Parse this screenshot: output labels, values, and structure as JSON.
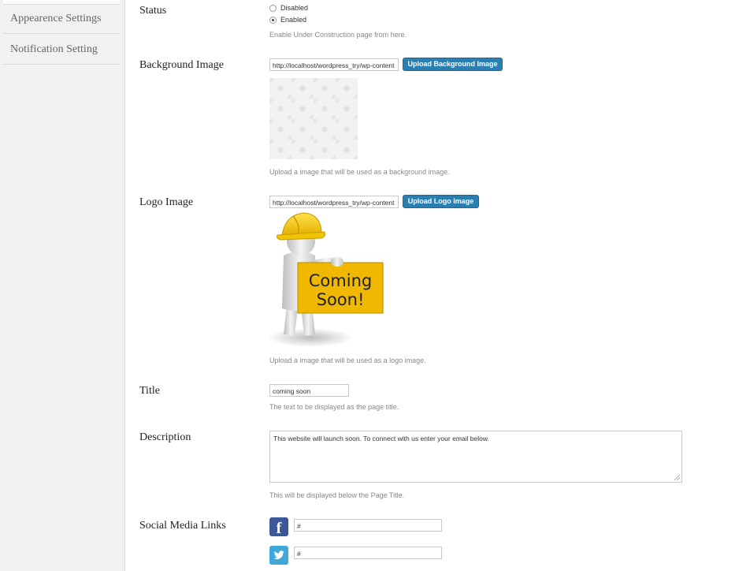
{
  "sidebar": {
    "items": [
      {
        "label": "Appearence Settings"
      },
      {
        "label": "Notification Setting"
      }
    ]
  },
  "status": {
    "label": "Status",
    "options": [
      "Disabled",
      "Enabled"
    ],
    "selected": "Enabled",
    "help": "Enable Under Construction page from here."
  },
  "background": {
    "label": "Background Image",
    "value": "http://localhost/wordpress_try/wp-content",
    "button": "Upload Background Image",
    "help": "Upload a image that will be used as a background image."
  },
  "logo": {
    "label": "Logo Image",
    "value": "http://localhost/wordpress_try/wp-content",
    "button": "Upload Logo Image",
    "sign_line1": "Coming",
    "sign_line2": "Soon!",
    "help": "Upload a image that will be used as a logo image."
  },
  "title": {
    "label": "Title",
    "value": "coming soon",
    "help": "The text to be displayed as the page title."
  },
  "description": {
    "label": "Description",
    "value": "This website will launch soon. To connect with us enter your email below.",
    "help": "This will be displayed below the Page Title."
  },
  "social": {
    "label": "Social Media Links",
    "facebook_icon": "f",
    "facebook_value": "#",
    "twitter_value": "#"
  },
  "colors": {
    "button": "#2a7fb0",
    "facebook": "#3b5998",
    "twitter": "#3fa9dc",
    "sign": "#f0b800"
  }
}
